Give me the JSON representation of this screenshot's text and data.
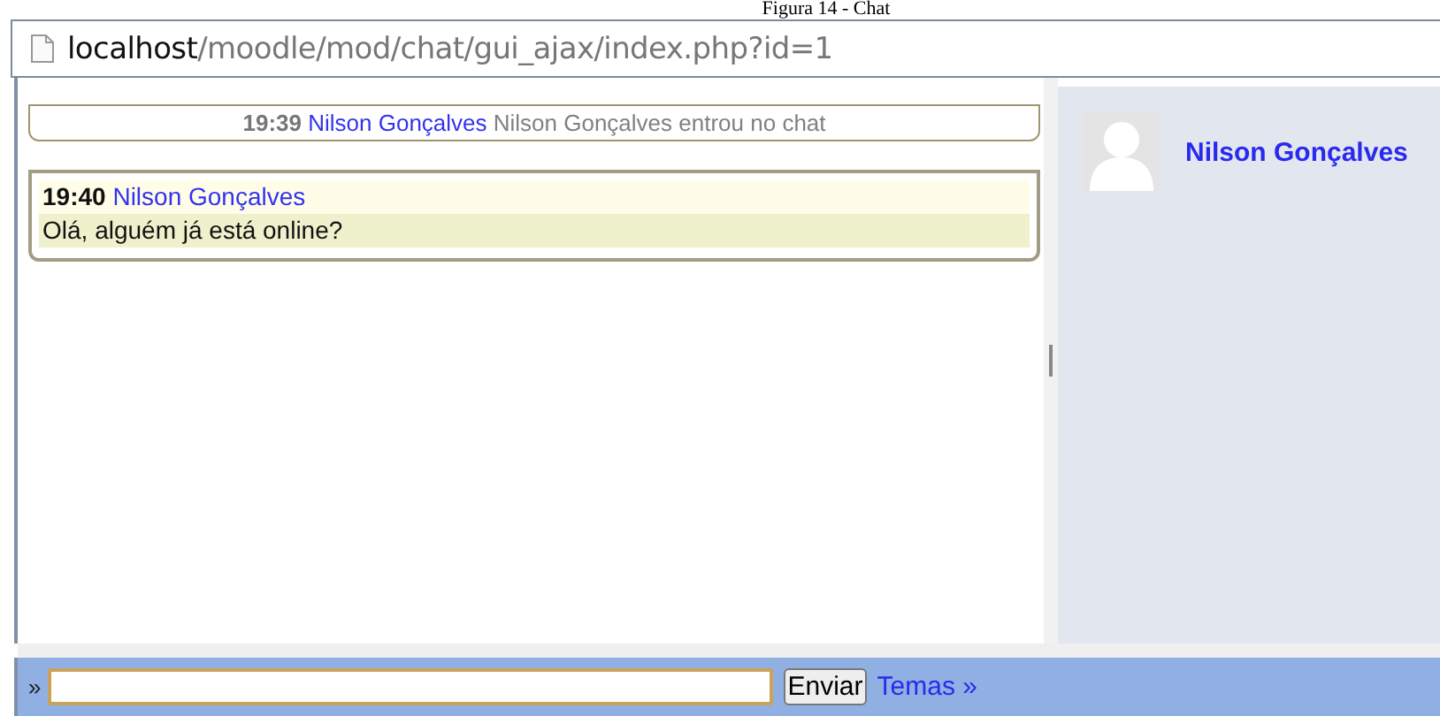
{
  "caption": "Figura 14 - Chat",
  "address_bar": {
    "host": "localhost",
    "path": "/moodle/mod/chat/gui_ajax/index.php?id=1"
  },
  "messages": [
    {
      "kind": "system",
      "time": "19:39",
      "user": "Nilson Gonçalves",
      "text": "Nilson Gonçalves entrou no chat"
    },
    {
      "kind": "message",
      "time": "19:40",
      "user": "Nilson Gonçalves",
      "text": "Olá, alguém já está online?"
    }
  ],
  "users": [
    {
      "name": "Nilson Gonçalves"
    }
  ],
  "input_bar": {
    "prompt": "»",
    "send_button": "Enviar",
    "themes_link": "Temas »"
  }
}
